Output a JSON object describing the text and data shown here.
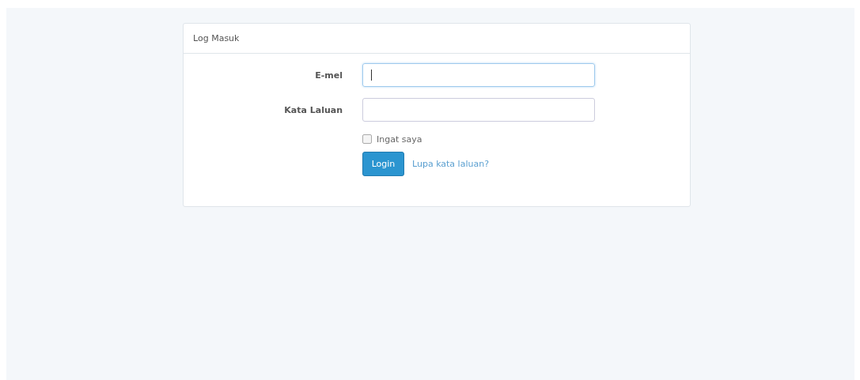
{
  "panel": {
    "title": "Log Masuk"
  },
  "fields": [
    {
      "label": "E-mel",
      "focused": true
    },
    {
      "label": "Kata Laluan",
      "focused": false
    }
  ],
  "remember": {
    "label": "Ingat saya",
    "checked": false
  },
  "login_button": "Login",
  "forgot_link": "Lupa kata laluan?"
}
